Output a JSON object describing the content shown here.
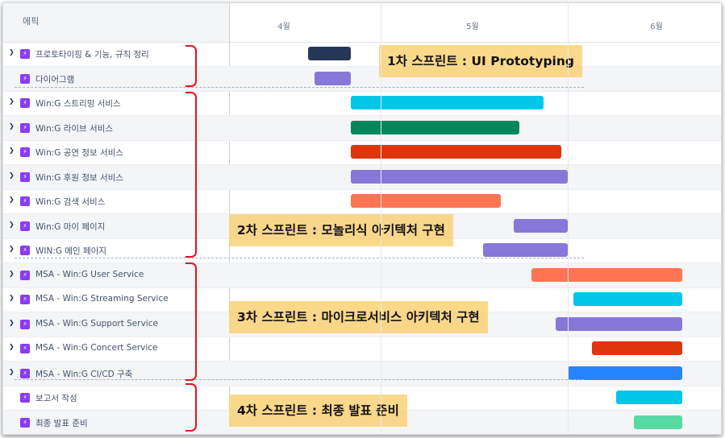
{
  "header": {
    "column_title": "에픽",
    "months": [
      "4월",
      "5월",
      "6월"
    ]
  },
  "epics": [
    {
      "label": "프로토타이핑 & 기능, 규칙 정리",
      "expandable": true,
      "color": "#253858"
    },
    {
      "label": "다이어그램",
      "expandable": false,
      "color": "#8777d9"
    },
    {
      "label": "Win:G 스트리밍 서비스",
      "expandable": true,
      "color": "#00c7e6"
    },
    {
      "label": "Win:G 라이브 서비스",
      "expandable": true,
      "color": "#00875a"
    },
    {
      "label": "Win:G 공연 정보 서비스",
      "expandable": true,
      "color": "#de350b"
    },
    {
      "label": "Win:G 후원 정보 서비스",
      "expandable": true,
      "color": "#8777d9"
    },
    {
      "label": "Win:G 검색 서비스",
      "expandable": true,
      "color": "#ff7452"
    },
    {
      "label": "Win:G 마이 페이지",
      "expandable": true,
      "color": "#8777d9"
    },
    {
      "label": "WIN:G 메인 페이지",
      "expandable": true,
      "color": "#8777d9"
    },
    {
      "label": "MSA - Win:G User Service",
      "expandable": true,
      "color": "#ff7452"
    },
    {
      "label": "MSA - Win:G Streaming Service",
      "expandable": true,
      "color": "#00c7e6"
    },
    {
      "label": "MSA - Win:G Support Service",
      "expandable": true,
      "color": "#8777d9"
    },
    {
      "label": "MSA - Win:G Concert Service",
      "expandable": true,
      "color": "#de350b"
    },
    {
      "label": "MSA - Win:G CI/CD 구축",
      "expandable": true,
      "color": "#2684ff"
    },
    {
      "label": "보고서 작성",
      "expandable": false,
      "color": "#00c7e6"
    },
    {
      "label": "최종 발표 준비",
      "expandable": false,
      "color": "#57d9a3"
    }
  ],
  "sprints": [
    {
      "label": "1차 스프린트 : UI Prototyping"
    },
    {
      "label": "2차 스프린트 : 모놀리식 아키텍처 구현"
    },
    {
      "label": "3차 스프린트 : 마이크로서비스 아키텍처 구현"
    },
    {
      "label": "4차 스프린트 : 최종 발표 준비"
    }
  ],
  "colors": {
    "brace": "#e3131b",
    "epic_icon": "#8b3bf2",
    "sprint_highlight": "#facf6e"
  }
}
